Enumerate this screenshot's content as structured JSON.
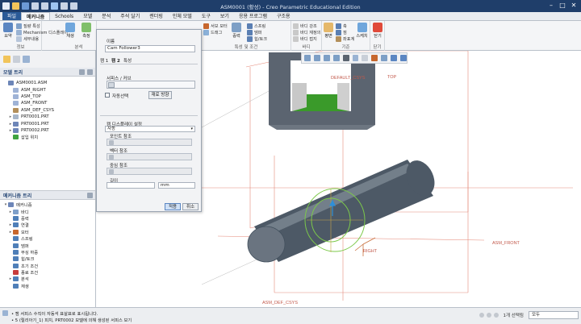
{
  "window": {
    "title": "ASM0001 (활성) - Creo Parametric Educational Edition",
    "controls": [
      "–",
      "□",
      "✕"
    ]
  },
  "menu": {
    "tabs": [
      {
        "label": "파일",
        "active": false,
        "file": true
      },
      {
        "label": "메커니즘",
        "active": true
      },
      {
        "label": "Schools"
      },
      {
        "label": "모델"
      },
      {
        "label": "분석"
      },
      {
        "label": "주석 달기"
      },
      {
        "label": "렌더링"
      },
      {
        "label": "인체 모델"
      },
      {
        "label": "도구"
      },
      {
        "label": "보기"
      },
      {
        "label": "응용 프로그램"
      },
      {
        "label": "구조용"
      }
    ]
  },
  "ribbon": {
    "groups": {
      "info": "정보",
      "analysis": "분석",
      "properties": "특성 및 조건",
      "body": "바디",
      "reference": "기준",
      "close": "닫기"
    },
    "buttons": {
      "summary": "요약",
      "detailed_info": "질량 특성",
      "mechanism_display": "Mechanism 디스플레이",
      "detail": "세부내용",
      "playback": "재생",
      "measure": "측정",
      "motor": "서보 모터",
      "drag": "드래그",
      "connect": "연결",
      "spring": "스프링",
      "damper": "댐퍼",
      "force": "힘/토크",
      "gravity": "중력",
      "initial": "초기 조건",
      "mass": "질량 특성",
      "termination": "종료 조건",
      "body_highlight": "바디 강조",
      "body_redefine": "바디 재정의",
      "body_ground": "바디 접지",
      "plane": "평면",
      "axis": "축",
      "point": "점",
      "csys": "좌표계",
      "sketch": "스케치",
      "close_label": "닫기"
    }
  },
  "model_tree": {
    "header": "모델 트리",
    "items": [
      {
        "label": "ASM0001.ASM",
        "expander": "",
        "color": "#6d86b8"
      },
      {
        "label": "ASM_RIGHT",
        "expander": "",
        "color": "#9fb3d6"
      },
      {
        "label": "ASM_TOP",
        "expander": "",
        "color": "#9fb3d6"
      },
      {
        "label": "ASM_FRONT",
        "expander": "",
        "color": "#9fb3d6"
      },
      {
        "label": "ASM_DEF_CSYS",
        "expander": "",
        "color": "#b38f5a"
      },
      {
        "label": "PRT0001.PRT",
        "expander": "▸",
        "color": "#a7b6c9"
      },
      {
        "label": "PRT0001.PRT",
        "expander": "▸",
        "color": "#6d86b8"
      },
      {
        "label": "PRT0002.PRT",
        "expander": "▸",
        "color": "#6d86b8"
      },
      {
        "label": "삽입 위치",
        "expander": "",
        "color": "#3fa341"
      }
    ]
  },
  "mechanism_tree": {
    "header": "메커니즘 트리",
    "items": [
      {
        "label": "메커니즘",
        "expander": "▾",
        "color": "#6d86b8"
      },
      {
        "label": "바디",
        "expander": "▸",
        "color": "#7fa0c9"
      },
      {
        "label": "중력",
        "expander": "",
        "color": "#4f7fb8"
      },
      {
        "label": "연결",
        "expander": "▸",
        "color": "#4f7fb8"
      },
      {
        "label": "모터",
        "expander": "▸",
        "color": "#c7672e"
      },
      {
        "label": "스프링",
        "expander": "",
        "color": "#4f7fb8"
      },
      {
        "label": "댐퍼",
        "expander": "",
        "color": "#4f7fb8"
      },
      {
        "label": "부싱 하중",
        "expander": "",
        "color": "#4f7fb8"
      },
      {
        "label": "힘/토크",
        "expander": "",
        "color": "#4f7fb8"
      },
      {
        "label": "초기 조건",
        "expander": "",
        "color": "#4f7fb8"
      },
      {
        "label": "종료 조건",
        "expander": "",
        "color": "#c73c3c"
      },
      {
        "label": "분석",
        "expander": "▸",
        "color": "#4f7fb8"
      },
      {
        "label": "재생",
        "expander": "",
        "color": "#4f7fb8"
      }
    ]
  },
  "dialog": {
    "name_label": "이름",
    "name_value": "Cam Follower3",
    "tab1": "캠 1",
    "tab2": "캠 2",
    "tab3": "특성",
    "surface_label": "서피스 / 커브",
    "auto_select": "자동선택",
    "flip": "재료 방향",
    "display_section": "캠 디스플레이 설정",
    "display_option": "자동",
    "point_ref": "포인트 참조",
    "vector_ref": "벡터 참조",
    "center_ref": "중심 참조",
    "length_label": "길이",
    "unit": "mm",
    "ok": "적용",
    "cancel": "취소"
  },
  "viewport": {
    "labels": {
      "default_csys": "DEFAULT_CSYS",
      "top": "TOP",
      "right": "RIGHT",
      "asm_front": "ASM_FRONT",
      "asm_def_csys": "ASM_DEF_CSYS"
    }
  },
  "status": {
    "line1": "• 캠 서피스 수직이 자동석 표살표로 표시됩니다.",
    "line2": "• 5 (릴리아기_1) 피치, PRT0002 모델에 의해 생성된 서피스 보기",
    "selected": "1개 선택됨",
    "filter": "모두"
  }
}
